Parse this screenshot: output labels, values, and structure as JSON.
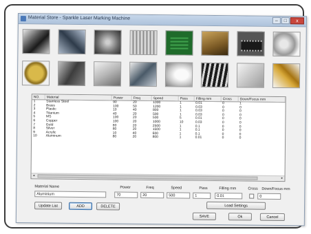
{
  "window": {
    "title": "Material Store - Sparkle Laser Marking Machine",
    "controls": {
      "minimize": "–",
      "maximize": "□",
      "close": "x"
    }
  },
  "thumbnails": [
    "steel-rod-photo",
    "steel-plate-photo",
    "brass-part-photo",
    "metal-sheet-photo",
    "circuit-board-photo",
    "brass-fitting-photo",
    "ic-chip-photo",
    "keychain-photo",
    "gold-tag-photo",
    "knife-photo",
    "tool-photo",
    "pen-photo",
    "led-bulb-photo",
    "keyboard-photo",
    "switch-plate-photo",
    "gold-hinge-photo"
  ],
  "table": {
    "columns": [
      "NO.",
      "Material",
      "Power",
      "Freq",
      "Speed",
      "Pass",
      "Filling mm",
      "Cross",
      "Down/Focus mm"
    ],
    "rows": [
      [
        "1",
        "Stainless Steel",
        "90",
        "20",
        "1000",
        "1",
        "0.01",
        "0",
        "1"
      ],
      [
        "2",
        "Brass",
        "100",
        "50",
        "1200",
        "1",
        "0.03",
        "0",
        "0"
      ],
      [
        "3",
        "Plastic",
        "10",
        "40",
        "800",
        "1",
        "0.03",
        "0",
        "0"
      ],
      [
        "4",
        "Titanium",
        "40",
        "20",
        "500",
        "1",
        "0.03",
        "0",
        "0"
      ],
      [
        "5",
        "MS",
        "100",
        "20",
        "500",
        "5",
        "0.01",
        "0",
        "0"
      ],
      [
        "6",
        "Copper",
        "100",
        "20",
        "1000",
        "10",
        "0.03",
        "0",
        "0"
      ],
      [
        "7",
        "Gold",
        "80",
        "20",
        "2500",
        "1",
        "0.1",
        "0",
        "0"
      ],
      [
        "8",
        "Silver",
        "80",
        "20",
        "1500",
        "1",
        "0.1",
        "0",
        "0"
      ],
      [
        "9",
        "Acrylic",
        "10",
        "40",
        "600",
        "1",
        "0.1",
        "0",
        "0"
      ],
      [
        "10",
        "Aluminum",
        "80",
        "20",
        "800",
        "1",
        "0.01",
        "0",
        "0"
      ]
    ]
  },
  "scrollbar": {
    "left_arrow": "◂",
    "right_arrow": "▸"
  },
  "form": {
    "labels": {
      "material_name": "Material Name",
      "power": "Power",
      "freq": "Freq",
      "speed": "Speed",
      "pass": "Pass",
      "filling": "Filling mm",
      "cross": "Cross",
      "down_focus": "Down/Focus mm"
    },
    "values": {
      "material_name": "Aluminium",
      "power": "70",
      "freq": "20",
      "speed": "500",
      "pass": "1",
      "filling": "0.01",
      "cross_checked": false,
      "down_focus": "0"
    }
  },
  "buttons": {
    "update_list": "Update List",
    "add": "ADD",
    "delete": "DELETE",
    "load_settings": "Load Settings",
    "save": "SAVE",
    "ok": "Ok",
    "cancel": "Cancel"
  }
}
